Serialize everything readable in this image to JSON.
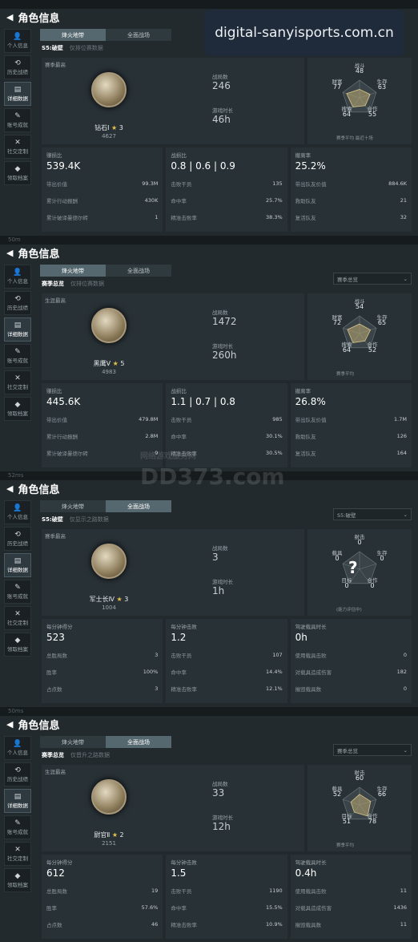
{
  "watermark_banner": "digital-sanyisports.com.cn",
  "watermark_dd": "DD373.com",
  "watermark_cn": "网络游戏服务网",
  "panels": [
    {
      "title": "角色信息",
      "strip": "",
      "sidebar": [
        "个人信息",
        "历史战绩",
        "详细数据",
        "账号成就",
        "社交定制",
        "领取档案"
      ],
      "active_side": 2,
      "tabs": [
        "烽火地带",
        "全面战场"
      ],
      "active_tab": 0,
      "season": "S5:破壁",
      "check": "仅排位赛数据",
      "dropdown": "",
      "rank_header": "赛季最高",
      "rank_name": "钻石Ⅰ",
      "stars": "3",
      "rank_score": "4627",
      "mid": {
        "l1": "战局数",
        "v1": "246",
        "l2": "游戏时长",
        "v2": "46h"
      },
      "radar": {
        "top": "战斗",
        "top_v": "48",
        "right": "生存",
        "right_v": "63",
        "bottom_right": "合作",
        "bottom_right_v": "55",
        "bottom_left": "搜索",
        "bottom_left_v": "64",
        "left": "财富",
        "left_v": "77",
        "legend_a": "赛季平均",
        "legend_b": "最近十场"
      },
      "col1": {
        "head": "赚损比",
        "big": "539.4K",
        "rows": [
          [
            "带出价值",
            "99.3M"
          ],
          [
            "累计行动报酬",
            "430K"
          ],
          [
            "累计破译曼德尔砖",
            "1"
          ]
        ]
      },
      "col2": {
        "head": "战损比",
        "big": "0.8  |  0.6  |  0.9",
        "rows": [
          [
            "击败干员",
            "135"
          ],
          [
            "命中率",
            "25.7%"
          ],
          [
            "精准击败率",
            "38.3%"
          ]
        ]
      },
      "col3": {
        "head": "撤离率",
        "big": "25.2%",
        "rows": [
          [
            "带出队友价值",
            "884.6K"
          ],
          [
            "救助队友",
            "21"
          ],
          [
            "复活队友",
            "32"
          ]
        ]
      }
    },
    {
      "title": "角色信息",
      "strip": "50m",
      "sidebar": [
        "个人信息",
        "历史战绩",
        "详细数据",
        "账号成就",
        "社交定制",
        "领取档案"
      ],
      "active_side": 2,
      "tabs": [
        "烽火地带",
        "全面战场"
      ],
      "active_tab": 0,
      "season": "赛季总览",
      "check": "仅排位赛数据",
      "dropdown": "赛季总览",
      "rank_header": "生涯最高",
      "rank_name": "黑鹰Ⅴ",
      "stars": "5",
      "rank_score": "4983",
      "mid": {
        "l1": "战局数",
        "v1": "1472",
        "l2": "游戏时长",
        "v2": "260h"
      },
      "radar": {
        "top": "战斗",
        "top_v": "54",
        "right": "生存",
        "right_v": "65",
        "bottom_right": "合作",
        "bottom_right_v": "52",
        "bottom_left": "搜索",
        "bottom_left_v": "64",
        "left": "财富",
        "left_v": "72",
        "legend_a": "赛季平均",
        "legend_b": ""
      },
      "col1": {
        "head": "赚损比",
        "big": "445.6K",
        "rows": [
          [
            "带出价值",
            "479.8M"
          ],
          [
            "累计行动报酬",
            "2.8M"
          ],
          [
            "累计破译曼德尔砖",
            "9"
          ]
        ]
      },
      "col2": {
        "head": "战损比",
        "big": "1.1  |  0.7  |  0.8",
        "rows": [
          [
            "击败干员",
            "985"
          ],
          [
            "命中率",
            "30.1%"
          ],
          [
            "精准击败率",
            "30.5%"
          ]
        ]
      },
      "col3": {
        "head": "撤离率",
        "big": "26.8%",
        "rows": [
          [
            "带出队友价值",
            "1.7M"
          ],
          [
            "救助队友",
            "126"
          ],
          [
            "复活队友",
            "164"
          ]
        ]
      }
    },
    {
      "title": "角色信息",
      "strip": "52ms",
      "sidebar": [
        "个人信息",
        "历史战绩",
        "详细数据",
        "账号成就",
        "社交定制",
        "领取档案"
      ],
      "active_side": 2,
      "tabs": [
        "烽火地带",
        "全面战场"
      ],
      "active_tab": 1,
      "season": "S5:破壁",
      "check": "仅显示之路数据",
      "dropdown": "S5:破壁",
      "rank_header": "赛季最高",
      "rank_name": "军士长Ⅳ",
      "stars": "3",
      "rank_score": "1004",
      "mid": {
        "l1": "战局数",
        "v1": "3",
        "l2": "游戏时长",
        "v2": "1h"
      },
      "radar": {
        "top": "射击",
        "top_v": "0",
        "right": "生存",
        "right_v": "0",
        "bottom_right": "合作",
        "bottom_right_v": "0",
        "bottom_left": "目标",
        "bottom_left_v": "0",
        "left": "载具",
        "left_v": "0",
        "legend_a": "(能力评估中)",
        "legend_b": ""
      },
      "col1": {
        "head": "每分钟得分",
        "big": "523",
        "rows": [
          [
            "总胜局数",
            "3"
          ],
          [
            "胜率",
            "100%"
          ],
          [
            "占点数",
            "3"
          ]
        ]
      },
      "col2": {
        "head": "每分钟击败",
        "big": "1.2",
        "rows": [
          [
            "击败干员",
            "107"
          ],
          [
            "命中率",
            "14.4%"
          ],
          [
            "精准击败率",
            "12.1%"
          ]
        ]
      },
      "col3": {
        "head": "驾驶载具时长",
        "big": "0h",
        "rows": [
          [
            "使用载具击败",
            "0"
          ],
          [
            "对载具造成伤害",
            "182"
          ],
          [
            "摧毁载具数",
            "0"
          ]
        ]
      }
    },
    {
      "title": "角色信息",
      "strip": "50ms",
      "sidebar": [
        "个人信息",
        "历史战绩",
        "详细数据",
        "账号成就",
        "社交定制",
        "领取档案"
      ],
      "active_side": 2,
      "tabs": [
        "烽火地带",
        "全面战场"
      ],
      "active_tab": 1,
      "season": "赛季总览",
      "check": "仅晋升之路数据",
      "dropdown": "赛季总览",
      "rank_header": "生涯最高",
      "rank_name": "尉官Ⅱ",
      "stars": "2",
      "rank_score": "2151",
      "mid": {
        "l1": "战局数",
        "v1": "33",
        "l2": "游戏时长",
        "v2": "12h"
      },
      "radar": {
        "top": "射击",
        "top_v": "60",
        "right": "生存",
        "right_v": "66",
        "bottom_right": "合作",
        "bottom_right_v": "78",
        "bottom_left": "目标",
        "bottom_left_v": "51",
        "left": "载具",
        "left_v": "52",
        "legend_a": "赛季平均",
        "legend_b": ""
      },
      "col1": {
        "head": "每分钟得分",
        "big": "612",
        "rows": [
          [
            "总胜局数",
            "19"
          ],
          [
            "胜率",
            "57.6%"
          ],
          [
            "占点数",
            "46"
          ]
        ]
      },
      "col2": {
        "head": "每分钟击败",
        "big": "1.5",
        "rows": [
          [
            "击败干员",
            "1190"
          ],
          [
            "命中率",
            "15.5%"
          ],
          [
            "精准击败率",
            "10.9%"
          ]
        ]
      },
      "col3": {
        "head": "驾驶载具时长",
        "big": "0.4h",
        "rows": [
          [
            "使用载具击败",
            "11"
          ],
          [
            "对载具造成伤害",
            "1436"
          ],
          [
            "摧毁载具数",
            "11"
          ]
        ]
      }
    }
  ]
}
